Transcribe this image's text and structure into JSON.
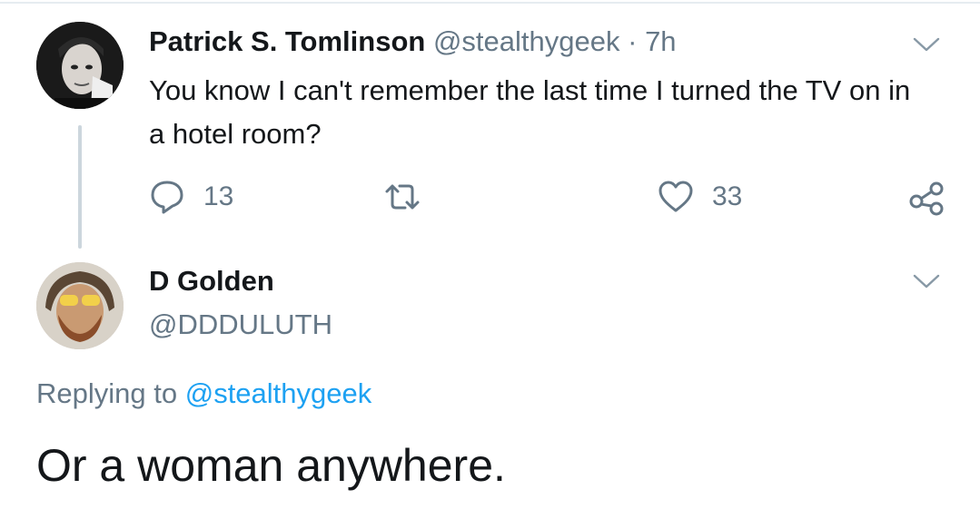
{
  "tweet1": {
    "author_name": "Patrick S. Tomlinson",
    "handle": "@stealthygeek",
    "separator": "·",
    "time": "7h",
    "text": "You know I can't remember the last time I turned the TV on in a hotel room?",
    "reply_count": "13",
    "like_count": "33",
    "icons": [
      "reply-icon",
      "retweet-icon",
      "like-icon",
      "share-icon",
      "chevron-down-icon"
    ]
  },
  "tweet2": {
    "author_name": "D Golden",
    "handle": "@DDDULUTH",
    "replying_prefix": "Replying to",
    "replying_to": "@stealthygeek",
    "text": "Or a woman anywhere.",
    "icons": [
      "chevron-down-icon"
    ]
  },
  "colors": {
    "text_primary": "#14171a",
    "text_secondary": "#657786",
    "link": "#1da1f2",
    "thread_line": "#ccd6dd"
  }
}
